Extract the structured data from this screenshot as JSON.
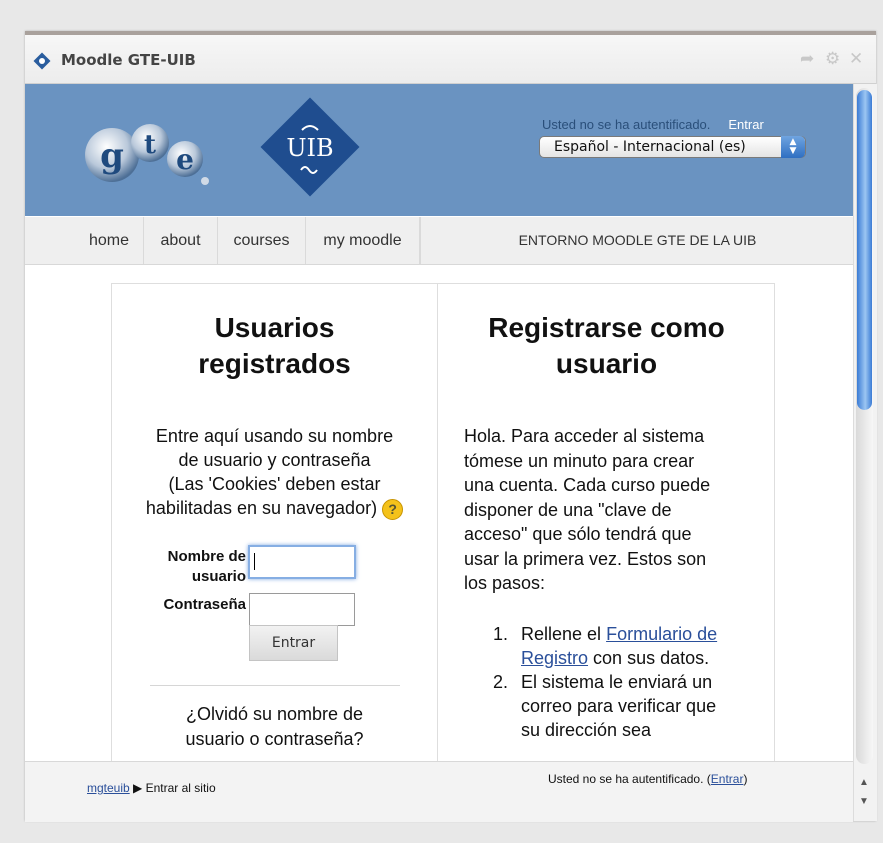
{
  "window": {
    "title": "Moodle GTE-UIB",
    "controls": [
      "share-icon",
      "gear-icon",
      "close-icon"
    ]
  },
  "header": {
    "logo_gte": "gte",
    "logo_uib": "UIB",
    "auth_status": "Usted no se ha autentificado.",
    "login_link": "Entrar",
    "language_selected": "Español ‎- Internacional ‎(es)‎"
  },
  "nav": {
    "items": [
      {
        "label": "home"
      },
      {
        "label": "about"
      },
      {
        "label": "courses"
      },
      {
        "label": "my moodle"
      }
    ],
    "site_title": "ENTORNO MOODLE GTE DE LA UIB"
  },
  "login": {
    "heading_line1": "Usuarios",
    "heading_line2": "registrados",
    "intro_line1": "Entre aquí usando su nombre",
    "intro_line2": "de usuario y contraseña",
    "intro_line3": "(Las 'Cookies' deben estar",
    "intro_line4": "habilitadas en su navegador)",
    "help_icon": "?",
    "username_label_line1": "Nombre de",
    "username_label_line2": "usuario",
    "username_value": "",
    "password_label": "Contraseña",
    "password_value": "",
    "submit_label": "Entrar",
    "forgot_line1": "¿Olvidó su nombre de",
    "forgot_line2": "usuario o contraseña?"
  },
  "signup": {
    "heading_line1": "Registrarse como",
    "heading_line2": "usuario",
    "intro_lines": [
      "Hola. Para acceder al sistema",
      "tómese un minuto para crear",
      "una cuenta. Cada curso puede",
      "disponer de una \"clave de",
      "acceso\" que sólo tendrá que",
      "usar la primera vez. Estos son",
      "los pasos:"
    ],
    "step1_num": "1.",
    "step1_text": "Rellene el",
    "step1_link_part1": "Formulario de",
    "step1_link_part2": "Registro",
    "step1_suffix": "con sus datos.",
    "step2_num": "2.",
    "step2_lines": [
      "El sistema le enviará un",
      "correo para verificar que",
      "su dirección sea"
    ]
  },
  "footer": {
    "breadcrumb_home": "mgteuib",
    "breadcrumb_sep": "▶",
    "breadcrumb_current": "Entrar al sitio",
    "auth_status": "Usted no se ha autentificado.",
    "login_open": "(",
    "login_link": "Entrar",
    "login_close": ")"
  },
  "colors": {
    "banner": "#6a93c1",
    "link": "#2a4f9a",
    "scroll_thumb": "#3a7bd5"
  }
}
